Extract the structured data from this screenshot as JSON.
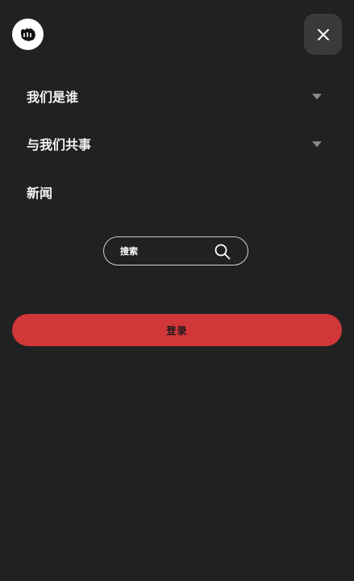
{
  "header": {
    "logo_icon": "fist-logo-icon",
    "close_icon": "close-icon"
  },
  "nav": {
    "items": [
      {
        "label": "我们是谁",
        "has_dropdown": true
      },
      {
        "label": "与我们共事",
        "has_dropdown": true
      },
      {
        "label": "新闻",
        "has_dropdown": false
      }
    ]
  },
  "search": {
    "placeholder": "搜索",
    "icon": "search-icon"
  },
  "login": {
    "label": "登录"
  },
  "colors": {
    "background": "#212121",
    "accent": "#d13639",
    "close_button_bg": "#3a3a3a"
  }
}
